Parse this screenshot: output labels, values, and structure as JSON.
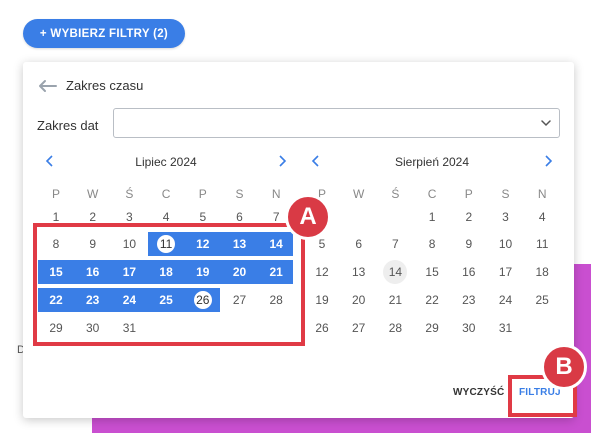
{
  "colors": {
    "accent": "#3a7ee6",
    "annotation": "#e03a45",
    "background_block": "#c94fd0"
  },
  "header": {
    "filters_button_label": "+ WYBIERZ FILTRY (2)"
  },
  "background": {
    "partial_letter": "D"
  },
  "panel": {
    "title": "Zakres czasu",
    "back_icon": "arrow-left-icon",
    "date_range_label": "Zakres dat",
    "date_range_value": "",
    "calendars": [
      {
        "month_title": "Lipiec 2024",
        "weekdays": [
          "P",
          "W",
          "Ś",
          "C",
          "P",
          "S",
          "N"
        ],
        "weeks": [
          [
            "1",
            "2",
            "3",
            "4",
            "5",
            "6",
            "7"
          ],
          [
            "8",
            "9",
            "10",
            "11",
            "12",
            "13",
            "14"
          ],
          [
            "15",
            "16",
            "17",
            "18",
            "19",
            "20",
            "21"
          ],
          [
            "22",
            "23",
            "24",
            "25",
            "26",
            "27",
            "28"
          ],
          [
            "29",
            "30",
            "31",
            "",
            "",
            "",
            ""
          ]
        ],
        "range_start": "11",
        "range_end": "26"
      },
      {
        "month_title": "Sierpień 2024",
        "weekdays": [
          "P",
          "W",
          "Ś",
          "C",
          "P",
          "S",
          "N"
        ],
        "weeks": [
          [
            "",
            "",
            "",
            "1",
            "2",
            "3",
            "4"
          ],
          [
            "5",
            "6",
            "7",
            "8",
            "9",
            "10",
            "11"
          ],
          [
            "12",
            "13",
            "14",
            "15",
            "16",
            "17",
            "18"
          ],
          [
            "19",
            "20",
            "21",
            "22",
            "23",
            "24",
            "25"
          ],
          [
            "26",
            "27",
            "28",
            "29",
            "30",
            "31",
            ""
          ]
        ],
        "today": "14"
      }
    ],
    "clear_label": "WYCZYŚĆ",
    "filter_label": "FILTRUJ"
  },
  "annotations": {
    "a_label": "A",
    "b_label": "B"
  }
}
